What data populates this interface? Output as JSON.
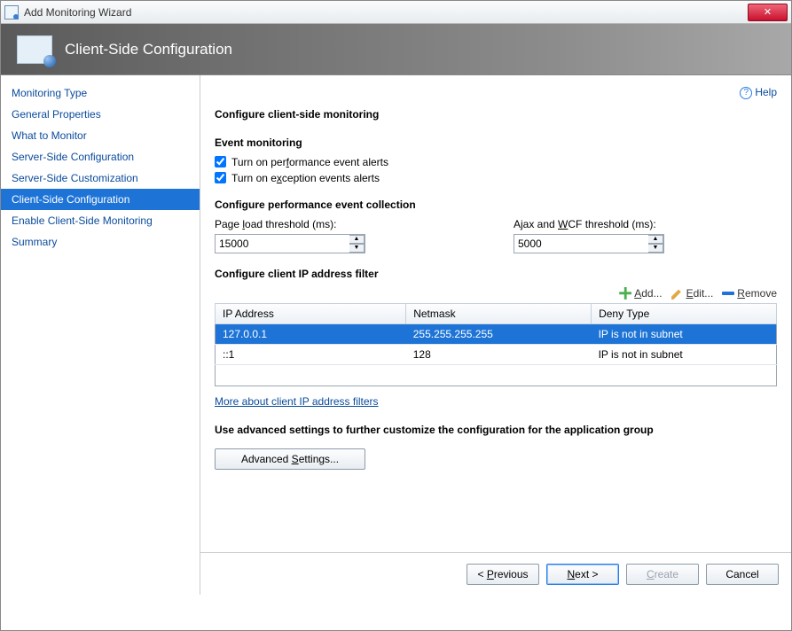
{
  "window": {
    "title": "Add Monitoring Wizard"
  },
  "banner": {
    "title": "Client-Side Configuration"
  },
  "help": {
    "label": "Help"
  },
  "sidebar": {
    "items": [
      {
        "label": "Monitoring Type"
      },
      {
        "label": "General Properties"
      },
      {
        "label": "What to Monitor"
      },
      {
        "label": "Server-Side Configuration"
      },
      {
        "label": "Server-Side Customization"
      },
      {
        "label": "Client-Side Configuration"
      },
      {
        "label": "Enable Client-Side Monitoring"
      },
      {
        "label": "Summary"
      }
    ],
    "active_index": 5
  },
  "content": {
    "main_heading": "Configure client-side monitoring",
    "event_section": {
      "title": "Event monitoring",
      "perf_checkbox": {
        "checked": true,
        "pre": "Turn on per",
        "u": "f",
        "post": "ormance event alerts"
      },
      "exc_checkbox": {
        "checked": true,
        "pre": "Turn on e",
        "u": "x",
        "post": "ception events alerts"
      }
    },
    "perf_section": {
      "title": "Configure performance event collection",
      "page_load": {
        "pre": "Page ",
        "u": "l",
        "post": "oad threshold (ms):",
        "value": "15000"
      },
      "ajax": {
        "pre": "Ajax and ",
        "u": "W",
        "post": "CF threshold (ms):",
        "value": "5000"
      }
    },
    "ip_section": {
      "title": "Configure client IP address filter",
      "toolbar": {
        "add": {
          "u": "A",
          "post": "dd..."
        },
        "edit": {
          "u": "E",
          "post": "dit..."
        },
        "remove": {
          "u": "R",
          "post": "emove"
        }
      },
      "columns": {
        "c0": "IP Address",
        "c1": "Netmask",
        "c2": "Deny Type"
      },
      "rows": [
        {
          "ip": "127.0.0.1",
          "mask": "255.255.255.255",
          "deny": "IP is not in subnet",
          "selected": true
        },
        {
          "ip": "::1",
          "mask": "128",
          "deny": "IP is not in subnet",
          "selected": false
        }
      ],
      "more_link": "More about client IP address filters"
    },
    "advanced": {
      "desc": "Use advanced settings to further customize the configuration for the application group",
      "btn_pre": "Advanced ",
      "btn_u": "S",
      "btn_post": "ettings..."
    }
  },
  "footer": {
    "prev": {
      "lt": "< ",
      "u": "P",
      "post": "revious"
    },
    "next": {
      "u": "N",
      "post": "ext >"
    },
    "create": {
      "u": "C",
      "post": "reate"
    },
    "cancel": "Cancel"
  }
}
